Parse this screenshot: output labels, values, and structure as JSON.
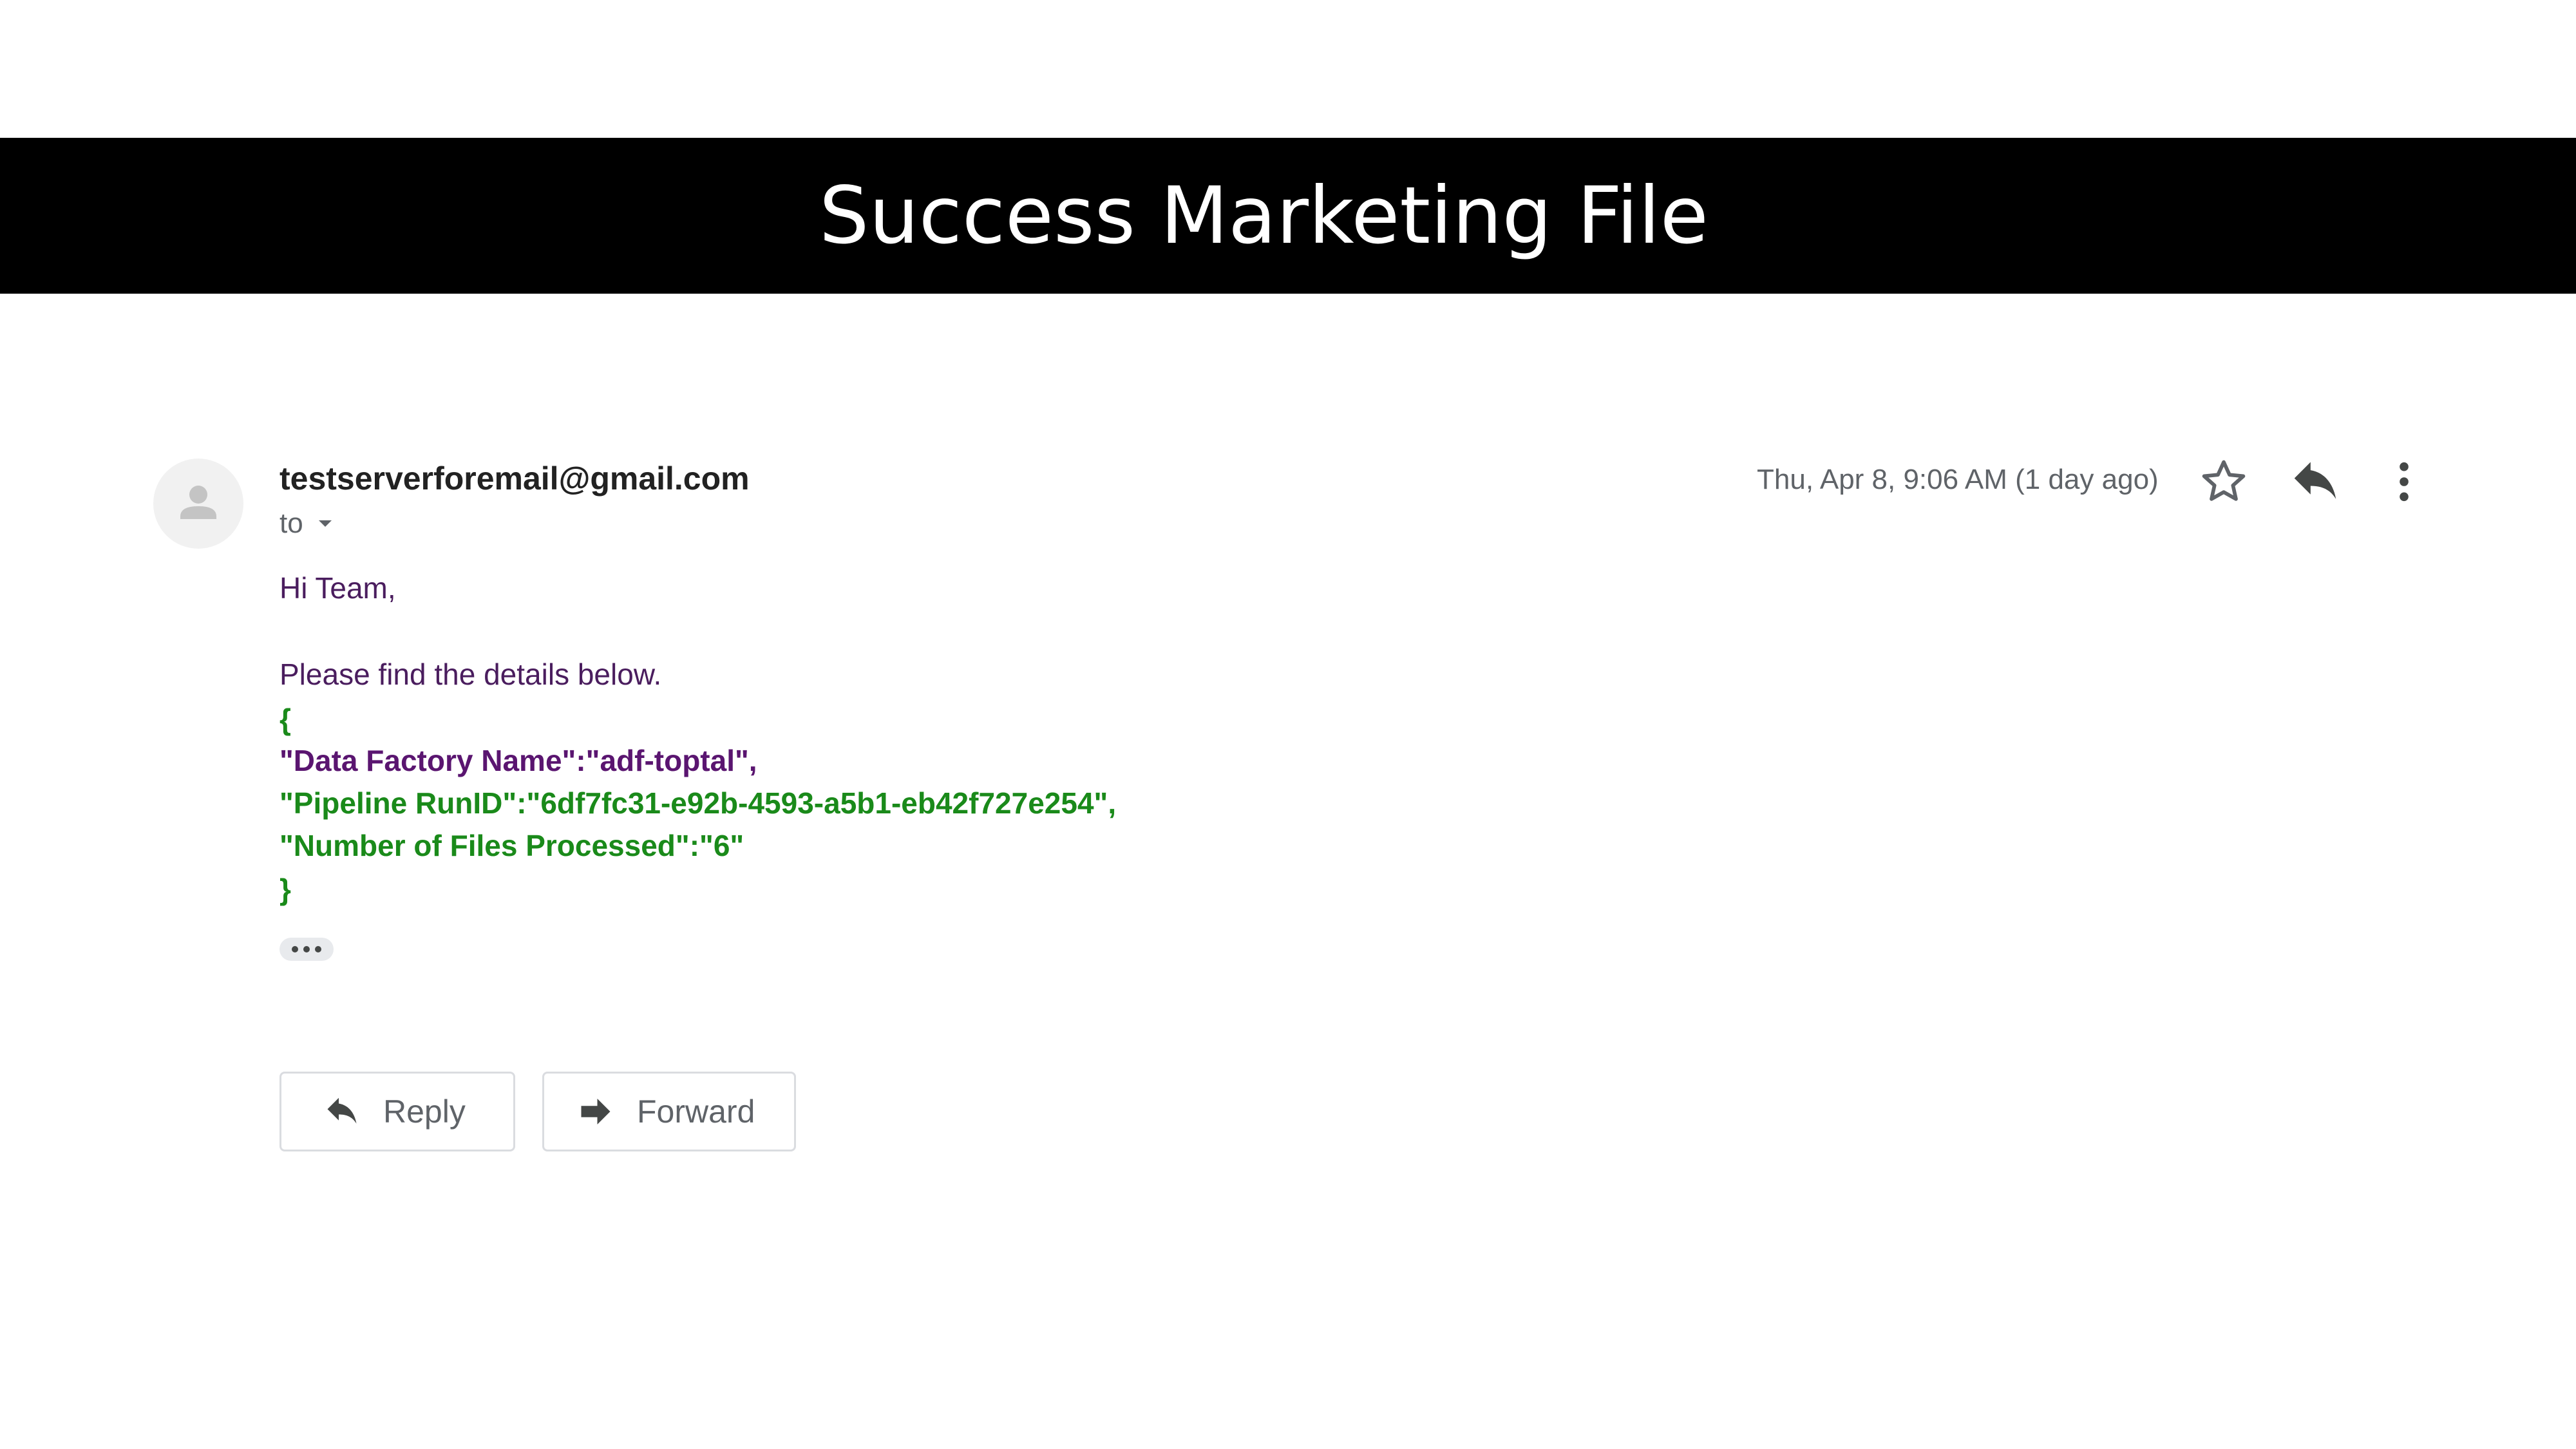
{
  "slide": {
    "title": "Success Marketing File"
  },
  "email": {
    "sender": "testserverforemail@gmail.com",
    "recipient_label": "to",
    "timestamp": "Thu, Apr 8, 9:06 AM (1 day ago)",
    "header_icons": [
      "star-icon",
      "reply-icon",
      "more-vert-icon"
    ],
    "body": {
      "greeting": "Hi Team,",
      "intro": "Please find the details below.",
      "json_open": "{",
      "line_data_factory": "\"Data Factory Name\":\"adf-toptal\",",
      "line_run_id": "\"Pipeline RunID\":\"6df7fc31-e92b-4593-a5b1-eb42f727e254\",",
      "line_files": "\"Number of Files Processed\":\"6\"",
      "json_close": "}"
    },
    "actions": {
      "reply_label": "Reply",
      "forward_label": "Forward"
    }
  },
  "colors": {
    "title_bar": "#000000",
    "intro_text": "#4a1d5e",
    "json_green": "#1a8a1a",
    "json_purple": "#5a1570"
  }
}
